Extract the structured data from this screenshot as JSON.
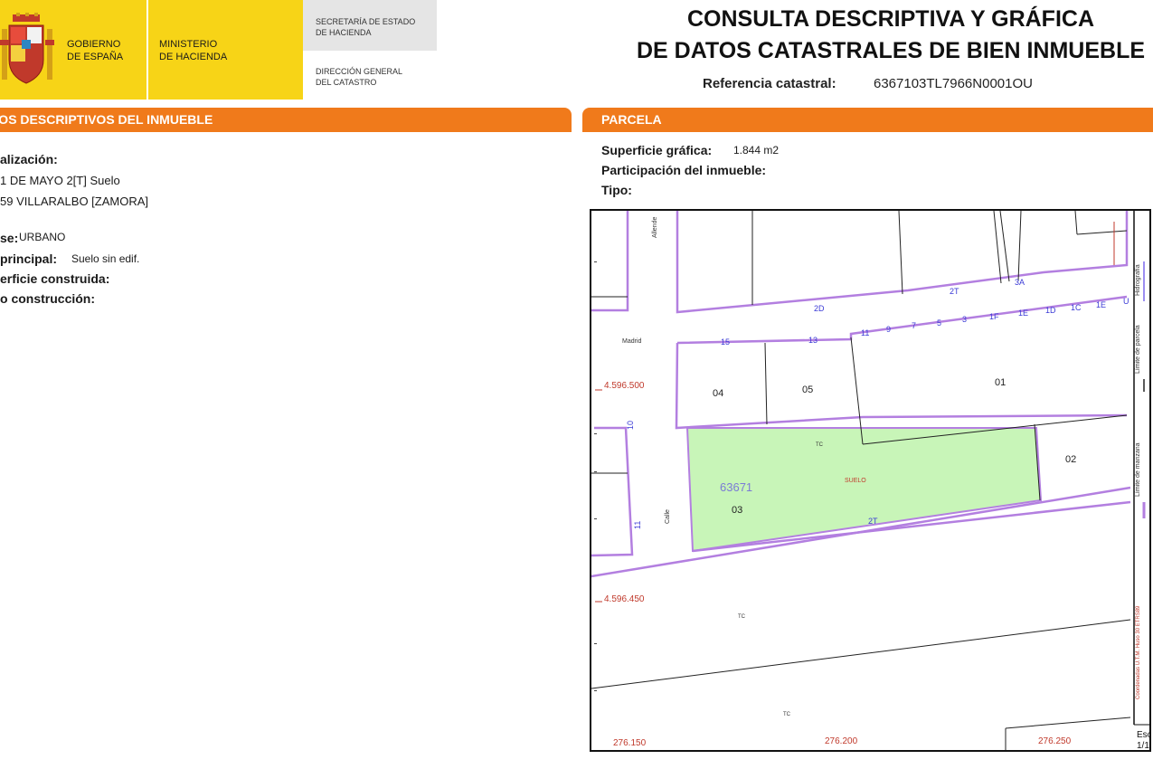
{
  "header": {
    "gobierno": [
      "GOBIERNO",
      "DE ESPAÑA"
    ],
    "ministerio": [
      "MINISTERIO",
      "DE HACIENDA"
    ],
    "secretaria": [
      "SECRETARÍA DE ESTADO",
      "DE HACIENDA"
    ],
    "direccion": [
      "DIRECCIÓN GENERAL",
      "DEL CATASTRO"
    ],
    "title_line1": "CONSULTA DESCRIPTIVA Y GRÁFICA",
    "title_line2": "DE DATOS CATASTRALES DE BIEN INMUEBLE",
    "ref_label": "Referencia catastral:",
    "ref_value": "6367103TL7966N0001OU"
  },
  "left_section": {
    "title": "TOS DESCRIPTIVOS DEL INMUEBLE",
    "localizacion_label": "alización:",
    "address_line1": "1 DE MAYO 2[T] Suelo",
    "address_line2": "59 VILLARALBO [ZAMORA]",
    "clase_label": "se:",
    "clase_value": "URBANO",
    "uso_label": "principal:",
    "uso_value": "Suelo sin edif.",
    "superficie_label": "erficie construida:",
    "construccion_label": "o construcción:"
  },
  "right_section": {
    "title": "PARCELA",
    "superficie_label": "Superficie gráfica:",
    "superficie_value": "1.844 m2",
    "participacion_label": "Participación del inmueble:",
    "tipo_label": "Tipo:"
  },
  "map": {
    "colors": {
      "parcel_fill": "#c8f5b8",
      "block_line": "#b37fe0",
      "number_blue": "#3b3bd6",
      "coord_red": "#c0392b"
    },
    "y_coord_1": "4.596.500",
    "y_coord_2": "4.596.450",
    "x_coords": [
      "276.150",
      "276.200",
      "276.250"
    ],
    "parcel_labels": [
      "04",
      "05",
      "01",
      "02",
      "03"
    ],
    "parcel_ref": "63671",
    "suelo": "SUELO",
    "tc": "TC",
    "street_numbers_top": [
      "2D",
      "2T",
      "3A"
    ],
    "street_numbers_row": [
      "11",
      "9",
      "7",
      "5",
      "3",
      "1F",
      "1E",
      "1D",
      "1C",
      "1E",
      "U"
    ],
    "street_numbers_left": [
      "15",
      "13"
    ],
    "number_2t_bottom": "2T",
    "vertical_numbers": [
      "10",
      "11"
    ],
    "street_names": [
      "Allende",
      "Madrid",
      "Calle"
    ],
    "legend": {
      "hidrografia": "Hidrografía",
      "limite_parcela": "Límite de parcela",
      "limite_manzana": "Límite de manzana",
      "coords_note": "Coordenadas U.T.M. Huso 30 ETRS89"
    },
    "escala": [
      "Esc",
      "1/1"
    ]
  }
}
